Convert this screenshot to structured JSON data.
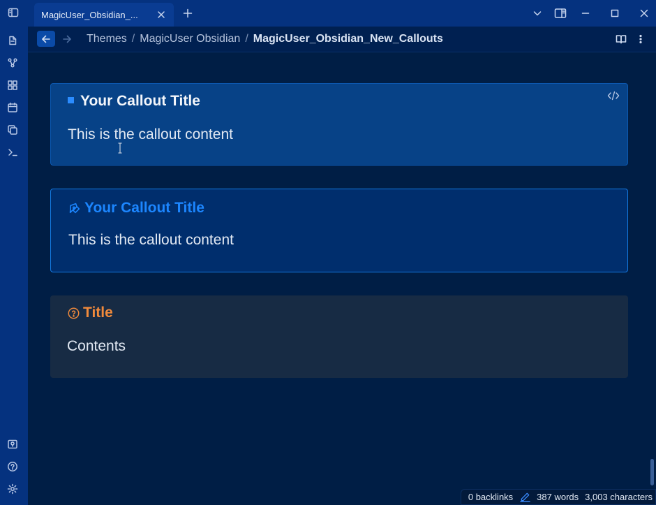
{
  "tab": {
    "title": "MagicUser_Obsidian_...",
    "close_icon": "close-icon",
    "new_tab_icon": "plus-icon"
  },
  "window": {
    "controls": [
      "chevron-down-icon",
      "sidebar-right-icon",
      "minimize-icon",
      "maximize-icon",
      "close-icon"
    ]
  },
  "ribbon": {
    "top_icons": [
      "files-icon",
      "graph-icon",
      "canvas-icon",
      "calendar-icon",
      "copy-icon",
      "terminal-icon"
    ],
    "bottom_icons": [
      "vault-icon",
      "help-icon",
      "settings-icon"
    ]
  },
  "breadcrumb": {
    "items": [
      "Themes",
      "MagicUser Obsidian"
    ],
    "separator": "/",
    "current": "MagicUser_Obsidian_New_Callouts"
  },
  "callouts": [
    {
      "title": "Your Callout Title",
      "content": "This is the callout content",
      "icon": "square-icon",
      "color": "#2b8cff"
    },
    {
      "title": "Your Callout Title",
      "content": "This is the callout content",
      "icon": "pen-tool-icon",
      "color": "#1c86ff"
    },
    {
      "title": "Title",
      "content": "Contents",
      "icon": "help-circle-icon",
      "color": "#f08a3c"
    }
  ],
  "status": {
    "backlinks": "0 backlinks",
    "words": "387 words",
    "characters": "3,003 characters"
  },
  "colors": {
    "ribbon": "#05327f",
    "editor_bg": "#001e45",
    "accent": "#1c86ff"
  }
}
